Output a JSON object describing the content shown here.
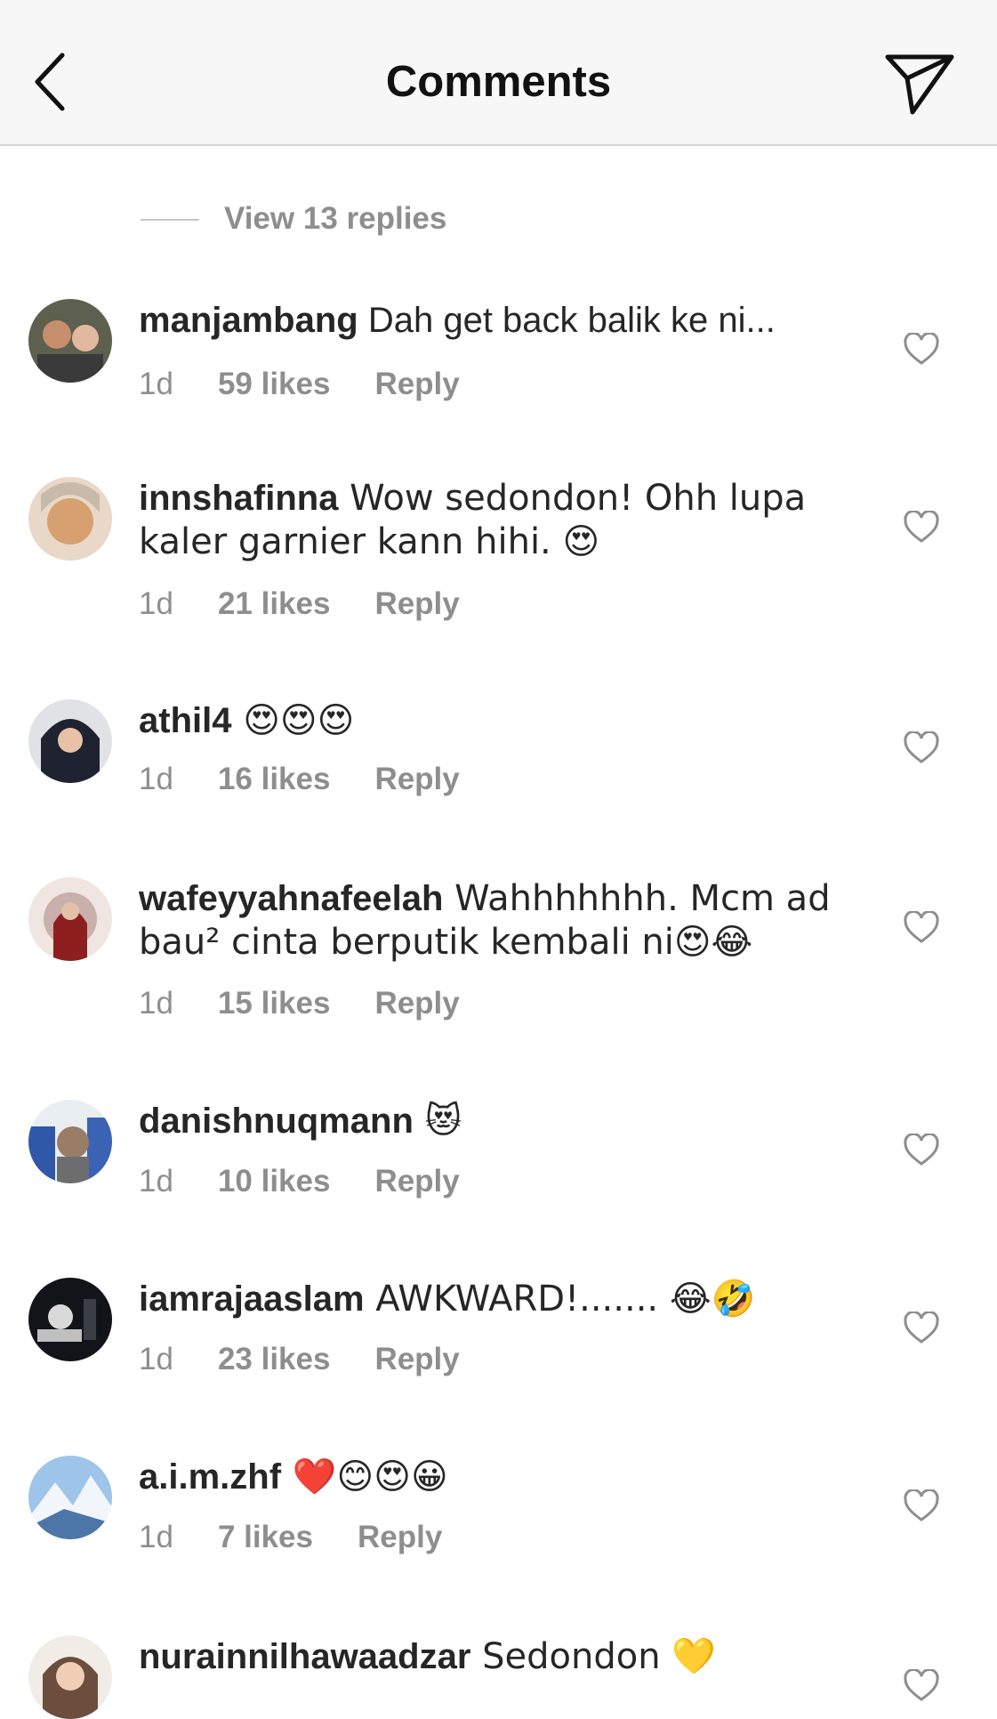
{
  "header": {
    "title": "Comments",
    "back_icon": "chevron-left-icon",
    "share_icon": "paper-plane-icon"
  },
  "view_replies": "View 13 replies",
  "comments": [
    {
      "username": "manjambang",
      "text": " Dah get back balik ke ni...",
      "time": "1d",
      "likes": "59 likes",
      "reply": "Reply"
    },
    {
      "username": "innshafinna",
      "text": " Wow sedondon! Ohh lupa kaler garnier kann hihi. 😍",
      "time": "1d",
      "likes": "21 likes",
      "reply": "Reply"
    },
    {
      "username": "athil4",
      "text": " 😍😍😍",
      "time": "1d",
      "likes": "16 likes",
      "reply": "Reply"
    },
    {
      "username": "wafeyyahnafeelah",
      "text": " Wahhhhhhh. Mcm ad bau² cinta berputik kembali ni😍😂",
      "time": "1d",
      "likes": "15 likes",
      "reply": "Reply"
    },
    {
      "username": "danishnuqmann",
      "text": " 😻",
      "time": "1d",
      "likes": "10 likes",
      "reply": "Reply"
    },
    {
      "username": "iamrajaaslam",
      "text": " AWKWARD!....... 😂🤣",
      "time": "1d",
      "likes": "23 likes",
      "reply": "Reply"
    },
    {
      "username": "a.i.m.zhf",
      "text": " ❤️😊😍😀",
      "time": "1d",
      "likes": "7 likes",
      "reply": "Reply"
    },
    {
      "username": "nurainnilhawaadzar",
      "text": " Sedondon 💛"
    }
  ],
  "colors": {
    "text": "#262626",
    "secondary": "#8e8e8e",
    "header_bg": "#f7f7f7"
  }
}
